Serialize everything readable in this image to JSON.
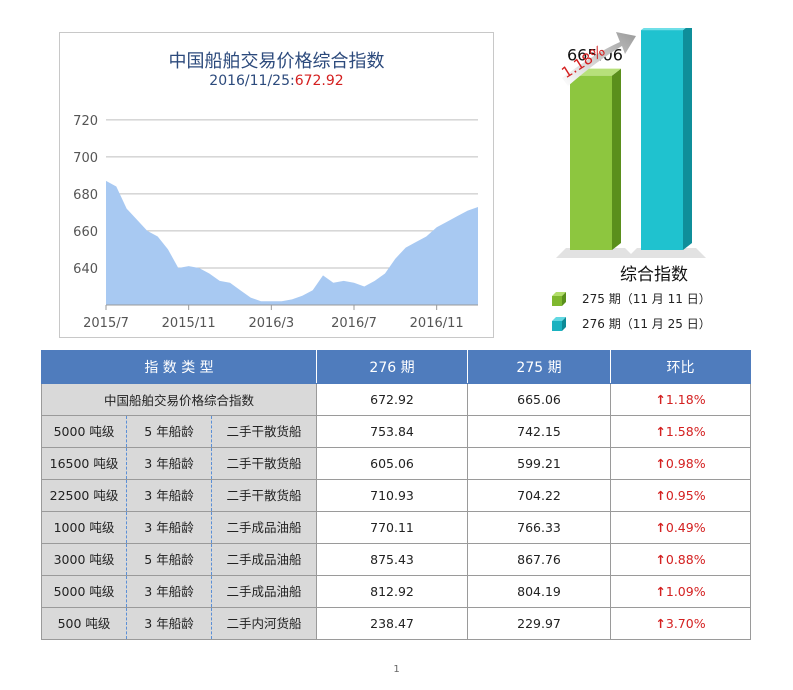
{
  "area_chart_text": {
    "title": "中国船舶交易价格综合指数",
    "subtitle_date": "2016/11/25:",
    "subtitle_value": "672.92"
  },
  "bar_text": {
    "change": "1.18%",
    "title": "综合指数",
    "legend": [
      "275 期（11 月 11 日）",
      "276 期（11 月 25 日）"
    ],
    "value_labels": [
      "665.06",
      "672.92"
    ]
  },
  "colors": {
    "area_fill": "#a8c9f2",
    "header_blue": "#4f7cbd",
    "bar_green": "#8dc63f",
    "bar_cyan": "#1fc2cf",
    "up_red": "#d42020"
  },
  "chart_data": [
    {
      "type": "area",
      "title": "中国船舶交易价格综合指数",
      "x_tick_labels": [
        "2015/7",
        "2015/11",
        "2016/3",
        "2016/7",
        "2016/11"
      ],
      "y_ticks": [
        640,
        660,
        680,
        700,
        720
      ],
      "ylim": [
        620,
        728
      ],
      "grid": true,
      "x": [
        0,
        1,
        2,
        3,
        4,
        5,
        6,
        7,
        8,
        9,
        10,
        11,
        12,
        13,
        14,
        15,
        16,
        17,
        18,
        19,
        20,
        21,
        22,
        23,
        24,
        25,
        26,
        27,
        28,
        29,
        30,
        31,
        32,
        33,
        34,
        35,
        36
      ],
      "x_tick_index": [
        0,
        8,
        16,
        24,
        32
      ],
      "values": [
        687,
        684,
        672,
        666,
        660,
        657,
        650,
        640,
        641,
        640,
        637,
        633,
        632,
        628,
        624,
        622,
        622,
        622,
        623,
        625,
        628,
        636,
        632,
        633,
        632,
        630,
        633,
        637,
        645,
        651,
        654,
        657,
        662,
        665,
        668,
        671,
        672.92
      ]
    },
    {
      "type": "bar",
      "categories": [
        "275 期（11 月 11 日）",
        "276 期（11 月 25 日）"
      ],
      "values": [
        665.06,
        672.92
      ]
    }
  ],
  "table": {
    "headers": [
      "指 数 类 型",
      "276 期",
      "275 期",
      "环比"
    ],
    "composite_row": {
      "name": "中国船舶交易价格综合指数",
      "v276": "672.92",
      "v275": "665.06",
      "change": "1.18%"
    },
    "rows": [
      {
        "tonnage": "5000 吨级",
        "age": "5 年船龄",
        "kind": "二手干散货船",
        "v276": "753.84",
        "v275": "742.15",
        "change": "1.58%"
      },
      {
        "tonnage": "16500 吨级",
        "age": "3 年船龄",
        "kind": "二手干散货船",
        "v276": "605.06",
        "v275": "599.21",
        "change": "0.98%"
      },
      {
        "tonnage": "22500 吨级",
        "age": "3 年船龄",
        "kind": "二手干散货船",
        "v276": "710.93",
        "v275": "704.22",
        "change": "0.95%"
      },
      {
        "tonnage": "1000 吨级",
        "age": "3 年船龄",
        "kind": "二手成品油船",
        "v276": "770.11",
        "v275": "766.33",
        "change": "0.49%"
      },
      {
        "tonnage": "3000 吨级",
        "age": "5 年船龄",
        "kind": "二手成品油船",
        "v276": "875.43",
        "v275": "867.76",
        "change": "0.88%"
      },
      {
        "tonnage": "5000 吨级",
        "age": "3 年船龄",
        "kind": "二手成品油船",
        "v276": "812.92",
        "v275": "804.19",
        "change": "1.09%"
      },
      {
        "tonnage": "500 吨级",
        "age": "3 年船龄",
        "kind": "二手内河货船",
        "v276": "238.47",
        "v275": "229.97",
        "change": "3.70%"
      }
    ],
    "up_arrow": "↑"
  },
  "page_number": "1"
}
